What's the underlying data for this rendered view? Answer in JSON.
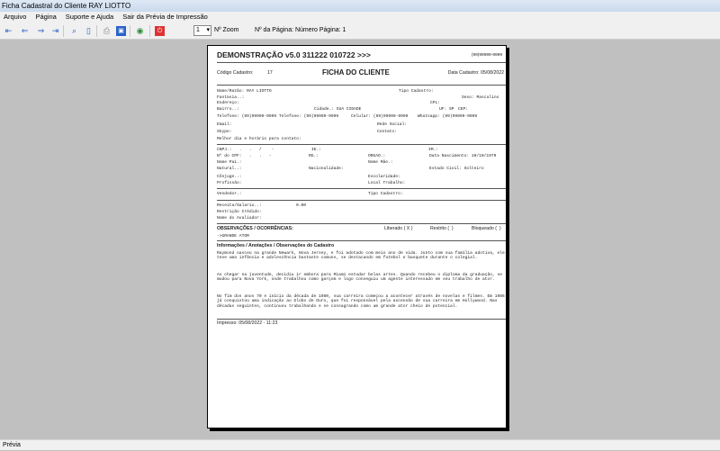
{
  "window": {
    "title": "Ficha Cadastral do Cliente RAY LIOTTO"
  },
  "menu": [
    "Arquivo",
    "Página",
    "Suporte e Ajuda",
    "Sair da Prévia de Impressão"
  ],
  "toolbar": {
    "zoom_value": "1",
    "zoom_label": "Nº Zoom",
    "page_label": "Nº da Página: Número Página: 1"
  },
  "report": {
    "header": "DEMONSTRAÇÃO v5.0 311222 010722 >>>",
    "phone": "(99)99999-9999",
    "codigo_label": "Código Cadastro:",
    "codigo": "17",
    "title": "FICHA DO CLIENTE",
    "data_cadastro": "Data Cadastro: 05/08/2022",
    "fields": {
      "nome": "Nome/Razão: RAY LIOTTO",
      "tipo1": "Tipo Cadastro:",
      "fantasia": "Fantasia..:",
      "sexo": "Sexo: Masculino",
      "endereco": "Endereço:",
      "cpl": "CPL:",
      "bairro": "Bairro..:",
      "cidade": "Cidade.: SUA CIDADE",
      "uf": "UF: SP",
      "cep": "CEP:",
      "tel1": "Telefone: (99)99999-9999",
      "tel2": "Telefone: (99)99999-9999",
      "celular": "Celular: (99)99999-9999",
      "whatsapp": "Whatsapp: (99)99999-9999",
      "email": "Email:",
      "rede": "Rede Social:",
      "skype": "Skype:",
      "contato": "Contato:",
      "melhor": "Melhor dia e horário para contato:",
      "cnpj": "CNPJ.:   .   .   /    -",
      "ie": "IE.:",
      "im": "IM.:",
      "cpf": "Nº do CPF:   .   .   -",
      "rg": "RG.:",
      "orgao": "ORGAO.:",
      "nasc": "Data Nascimento: 10/10/1979",
      "pai": "Nome Pai.:",
      "mae": "Nome Mãe.:",
      "natural": "Natural..:",
      "nacionalidade": "Nacionalidade:",
      "civil": "Estado Civil: Solteiro",
      "conjuge": "Cônjuge..:",
      "escolaridade": "Escolaridade:",
      "profissao": "Profissão:",
      "local": "Local Trabalho:",
      "vendedor": "Vendedor.:",
      "tipo2": "Tipo Cadastro:",
      "receita": "Receita/Salario..:",
      "receita_valor": "0.00",
      "restricao": "Restrição Crédido:",
      "avaliador": "Nome do Avaliador:"
    },
    "obs_title": "OBSERVAÇÕES / OCORRÊNCIAS:",
    "liberado": "Liberado ( X )",
    "restrito": "Restrito (  )",
    "bloqueado": "Bloqueado (  )",
    "obs_text": "->GRANDE ATOR",
    "info_title": "Informações / Anotações / Observações do Cadastro",
    "paragraphs": [
      "Raymond nasceu na grande Newark, Nova Jersey, e foi adotado com meio ano de vida. Junto com sua família adotiva, ele teve uma infância e adolescência bastante comuns, se destacando em futebol e basquete durante o colegial.",
      "Ao chegar na juventude, decidiu ir embora para Miami estudar belas artes. Quando recebeu o diploma da graduação, se mudou para Nova York, onde trabalhou como garçom e logo conseguiu um agente interessado em seu trabalho de ator.",
      "No fim dos anos 70 e início da década de 1980, sua carreira começou a acontecer através de novelas e filmes. Em 1986 já conquistou uma indicação ao Globo de Ouro, que foi responsável pela ascensão de sua carreira em Hollywood. Nas décadas seguintes, continuou trabalhando e se consagrando como um grande ator cheio de potencial."
    ],
    "printed": "Impresso: 05/08/2022 - 11:23"
  },
  "status": "Prévia"
}
